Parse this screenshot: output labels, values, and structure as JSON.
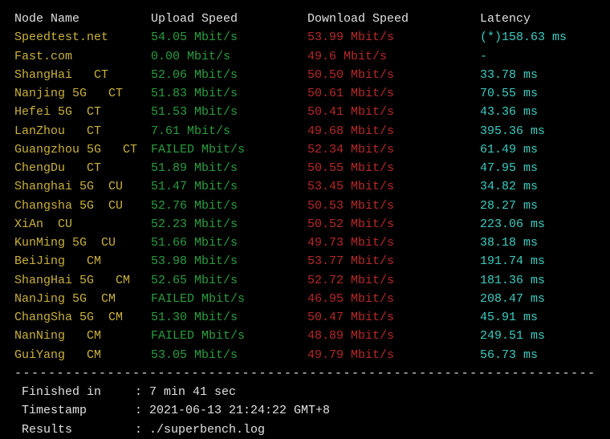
{
  "headers": {
    "node": "Node Name",
    "upload": "Upload Speed",
    "download": "Download Speed",
    "latency": "Latency"
  },
  "rows": [
    {
      "node": "Speedtest.net",
      "upload": "54.05 Mbit/s",
      "download": "53.99 Mbit/s",
      "latency": "(*)158.63 ms"
    },
    {
      "node": "Fast.com",
      "upload": "0.00 Mbit/s",
      "download": "49.6 Mbit/s",
      "latency": "-"
    },
    {
      "node": "ShangHai   CT",
      "upload": "52.06 Mbit/s",
      "download": "50.50 Mbit/s",
      "latency": "33.78 ms"
    },
    {
      "node": "Nanjing 5G   CT",
      "upload": "51.83 Mbit/s",
      "download": "50.61 Mbit/s",
      "latency": "70.55 ms"
    },
    {
      "node": "Hefei 5G  CT",
      "upload": "51.53 Mbit/s",
      "download": "50.41 Mbit/s",
      "latency": "43.36 ms"
    },
    {
      "node": "LanZhou   CT",
      "upload": "7.61 Mbit/s",
      "download": "49.68 Mbit/s",
      "latency": "395.36 ms"
    },
    {
      "node": "Guangzhou 5G   CT",
      "upload": "FAILED Mbit/s",
      "download": "52.34 Mbit/s",
      "latency": "61.49 ms"
    },
    {
      "node": "ChengDu   CT",
      "upload": "51.89 Mbit/s",
      "download": "50.55 Mbit/s",
      "latency": "47.95 ms"
    },
    {
      "node": "Shanghai 5G  CU",
      "upload": "51.47 Mbit/s",
      "download": "53.45 Mbit/s",
      "latency": "34.82 ms"
    },
    {
      "node": "Changsha 5G  CU",
      "upload": "52.76 Mbit/s",
      "download": "50.53 Mbit/s",
      "latency": "28.27 ms"
    },
    {
      "node": "XiAn  CU",
      "upload": "52.23 Mbit/s",
      "download": "50.52 Mbit/s",
      "latency": "223.06 ms"
    },
    {
      "node": "KunMing 5G  CU",
      "upload": "51.66 Mbit/s",
      "download": "49.73 Mbit/s",
      "latency": "38.18 ms"
    },
    {
      "node": "BeiJing   CM",
      "upload": "53.98 Mbit/s",
      "download": "53.77 Mbit/s",
      "latency": "191.74 ms"
    },
    {
      "node": "ShangHai 5G   CM",
      "upload": "52.65 Mbit/s",
      "download": "52.72 Mbit/s",
      "latency": "181.36 ms"
    },
    {
      "node": "NanJing 5G  CM",
      "upload": "FAILED Mbit/s",
      "download": "46.95 Mbit/s",
      "latency": "208.47 ms"
    },
    {
      "node": "ChangSha 5G  CM",
      "upload": "51.30 Mbit/s",
      "download": "50.47 Mbit/s",
      "latency": "45.91 ms"
    },
    {
      "node": "NanNing   CM",
      "upload": "FAILED Mbit/s",
      "download": "48.89 Mbit/s",
      "latency": "249.51 ms"
    },
    {
      "node": "GuiYang   CM",
      "upload": "53.05 Mbit/s",
      "download": "49.79 Mbit/s",
      "latency": "56.73 ms"
    }
  ],
  "divider": "----------------------------------------------------------------------",
  "footer": {
    "finished_label": " Finished in",
    "finished_value": ": 7 min 41 sec",
    "timestamp_label": " Timestamp",
    "timestamp_value": ": 2021-06-13 21:24:22 GMT+8",
    "results_label": " Results",
    "results_value": ": ./superbench.log"
  }
}
